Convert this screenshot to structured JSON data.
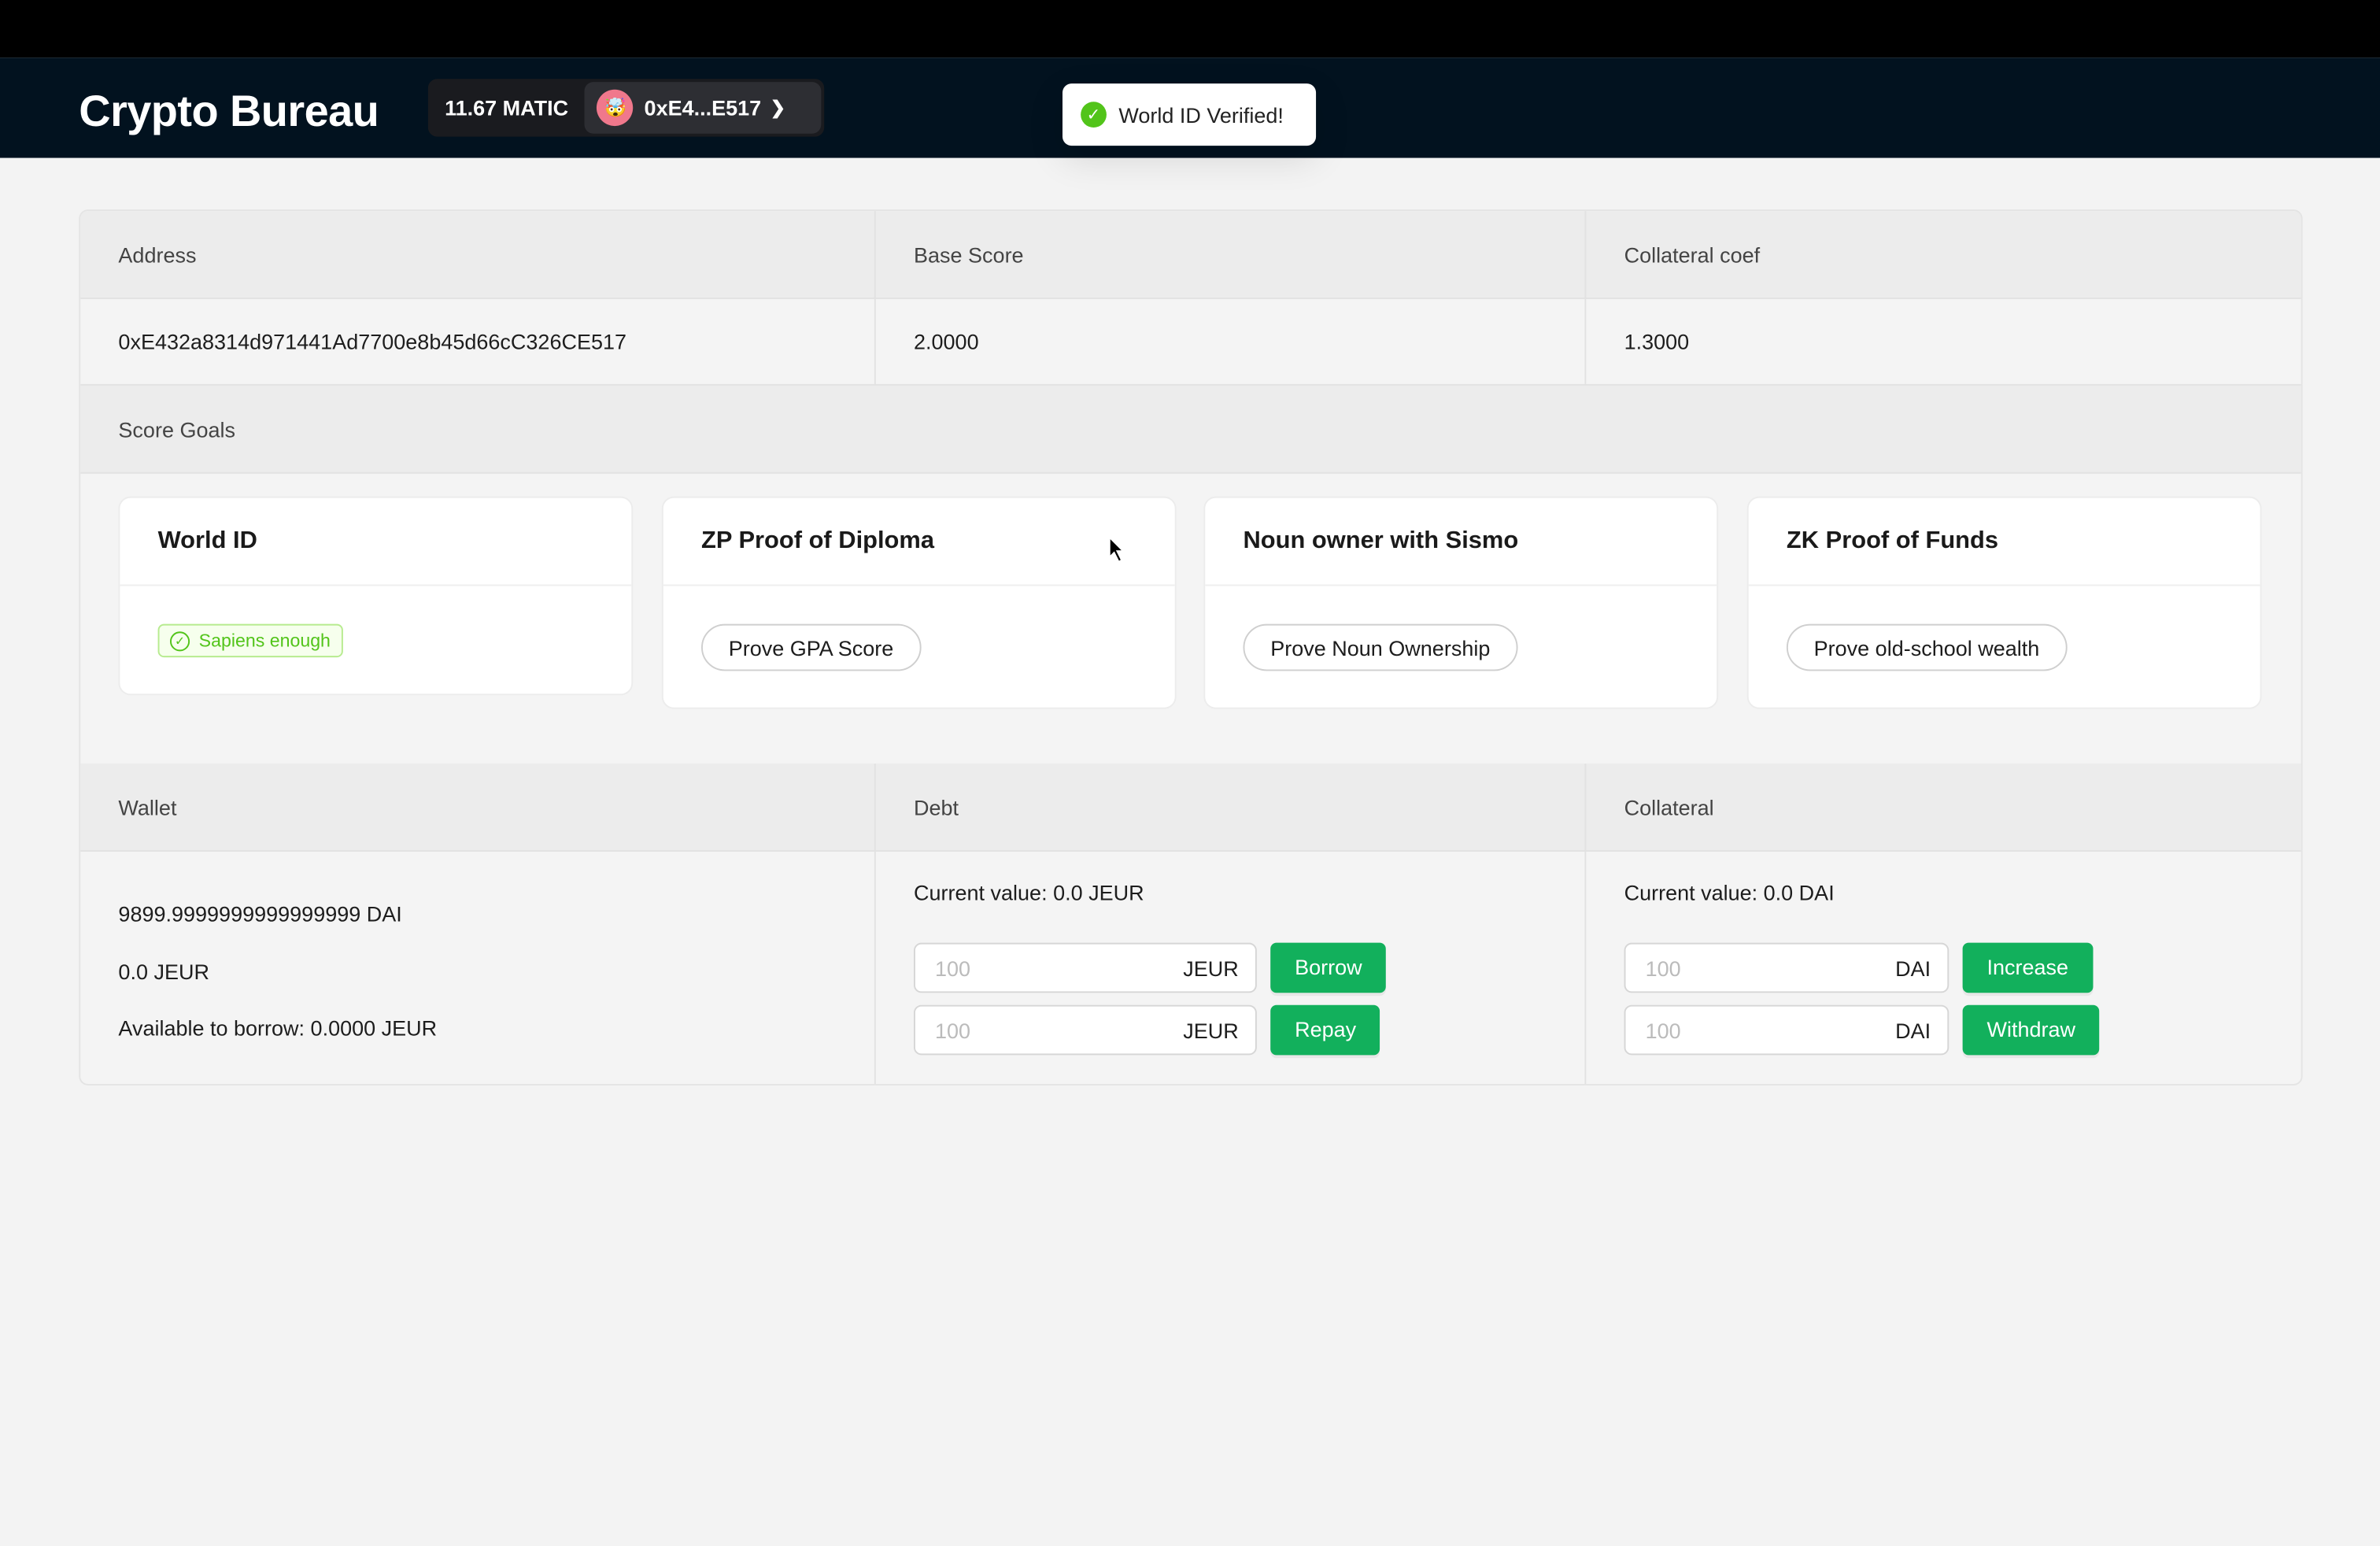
{
  "header": {
    "title": "Crypto Bureau",
    "balance": "11.67 MATIC",
    "account": "0xE4...E517",
    "avatar_emoji": "🤯"
  },
  "toast": {
    "message": "World ID Verified!"
  },
  "info": {
    "address_label": "Address",
    "base_score_label": "Base Score",
    "collateral_coef_label": "Collateral coef",
    "address": "0xE432a8314d971441Ad7700e8b45d66cC326CE517",
    "base_score": "2.0000",
    "collateral_coef": "1.3000"
  },
  "score_goals": {
    "label": "Score Goals",
    "cards": [
      {
        "title": "World ID",
        "badge": "Sapiens enough"
      },
      {
        "title": "ZP Proof of Diploma",
        "button": "Prove GPA Score"
      },
      {
        "title": "Noun owner with Sismo",
        "button": "Prove Noun Ownership"
      },
      {
        "title": "ZK Proof of Funds",
        "button": "Prove old-school wealth"
      }
    ]
  },
  "wallet": {
    "label": "Wallet",
    "dai": "9899.9999999999999999 DAI",
    "jeur": "0.0 JEUR",
    "available": "Available to borrow: 0.0000 JEUR"
  },
  "debt": {
    "label": "Debt",
    "current": "Current value: 0.0 JEUR",
    "placeholder": "100",
    "unit": "JEUR",
    "borrow": "Borrow",
    "repay": "Repay"
  },
  "collateral": {
    "label": "Collateral",
    "current": "Current value: 0.0 DAI",
    "placeholder": "100",
    "unit": "DAI",
    "increase": "Increase",
    "withdraw": "Withdraw"
  },
  "colors": {
    "accent": "#12b05c",
    "header_bg": "#02121f",
    "success": "#52c41a"
  }
}
